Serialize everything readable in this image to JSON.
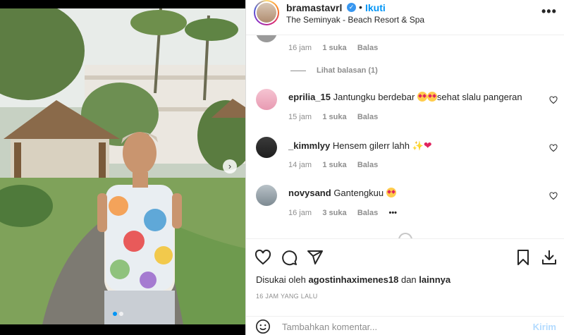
{
  "post": {
    "username": "bramastavrl",
    "follow_label": "Ikuti",
    "separator": "•",
    "location": "The Seminyak - Beach Resort & Spa",
    "more_label": "•••"
  },
  "comments": {
    "partial": {
      "time": "16 jam",
      "likes": "1 suka",
      "reply": "Balas"
    },
    "view_replies": "Lihat balasan (1)",
    "items": [
      {
        "user": "eprilia_15",
        "text": "Jantungku berdebar",
        "text2": "sehat slalu pangeran",
        "time": "15 jam",
        "likes": "1 suka",
        "reply": "Balas"
      },
      {
        "user": "_kimmlyy",
        "text": "Hensem gilerr lahh",
        "time": "14 jam",
        "likes": "1 suka",
        "reply": "Balas"
      },
      {
        "user": "novysand",
        "text": "Gantengkuu",
        "time": "16 jam",
        "likes": "3 suka",
        "reply": "Balas",
        "more": "•••"
      }
    ]
  },
  "footer": {
    "liked_by_prefix": "Disukai oleh",
    "liked_by_user": "agostinhaximenes18",
    "liked_by_suffix": "dan",
    "liked_by_others": "lainnya",
    "timestamp": "16 JAM YANG LALU",
    "comment_placeholder": "Tambahkan komentar...",
    "post_label": "Kirim"
  },
  "colors": {
    "accent": "#0095f6",
    "verified": "#3897f0"
  },
  "icons": [
    "heart-icon",
    "comment-icon",
    "share-icon",
    "bookmark-icon",
    "download-icon",
    "emoji-icon",
    "verified-icon",
    "next-arrow-icon"
  ]
}
